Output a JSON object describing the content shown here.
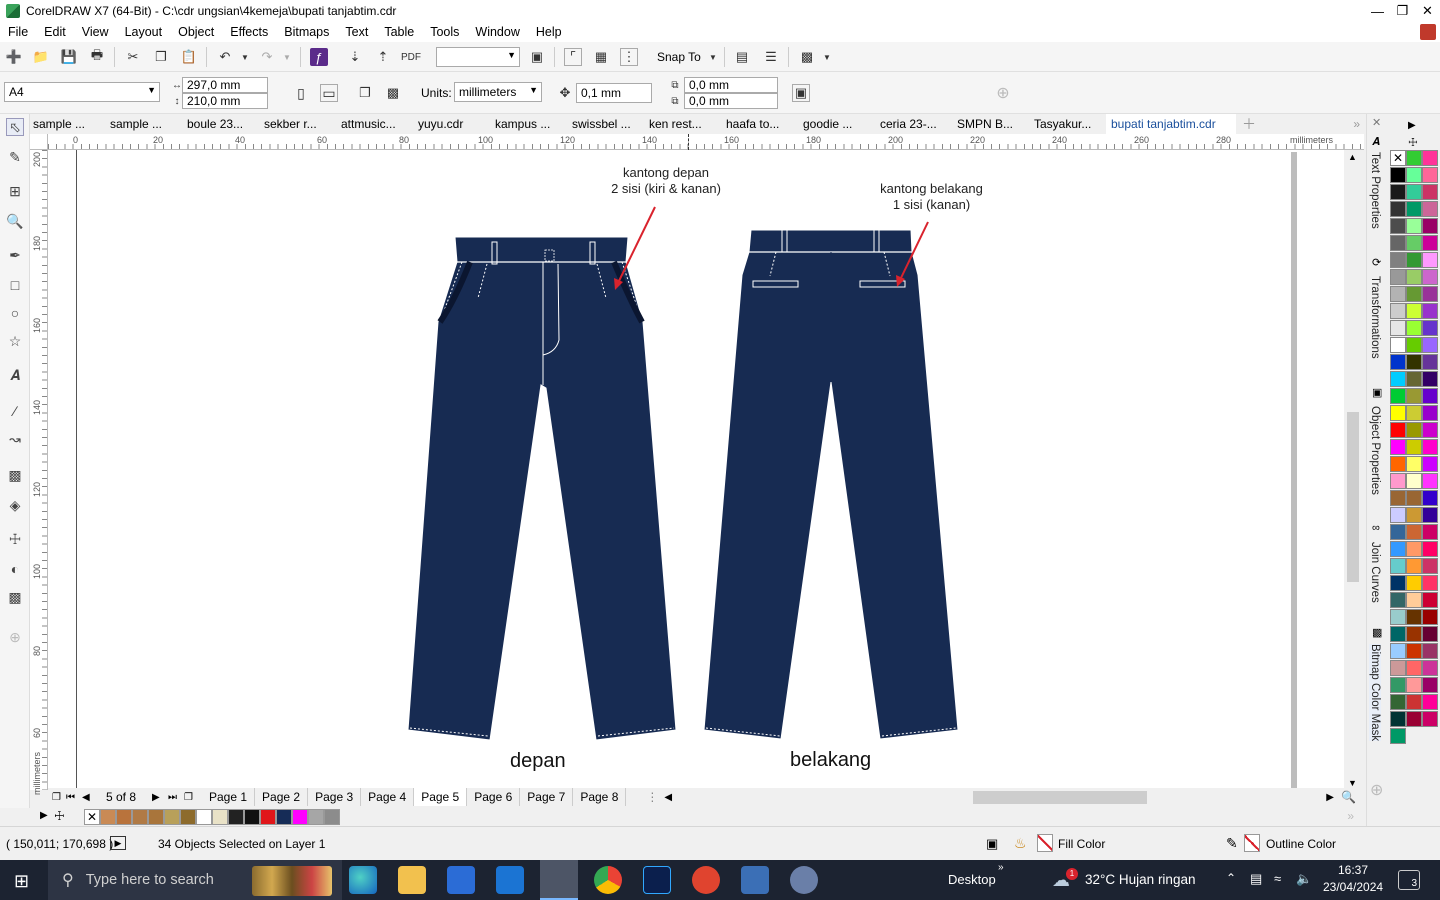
{
  "window": {
    "title": "CorelDRAW X7 (64-Bit) - C:\\cdr ungsian\\4kemeja\\bupati tanjabtim.cdr"
  },
  "menu": [
    "File",
    "Edit",
    "View",
    "Layout",
    "Object",
    "Effects",
    "Bitmaps",
    "Text",
    "Table",
    "Tools",
    "Window",
    "Help"
  ],
  "standard_toolbar": {
    "snap_label": "Snap To",
    "zoom_value": ""
  },
  "property_bar": {
    "page_size": "A4",
    "width": "297,0 mm",
    "height": "210,0 mm",
    "units_label": "Units:",
    "units_value": "millimeters",
    "nudge": "0,1 mm",
    "dup_x": "0,0 mm",
    "dup_y": "0,0 mm"
  },
  "doc_tabs": [
    "sample ...",
    "sample ...",
    "boule 23...",
    "sekber r...",
    "attmusic...",
    "yuyu.cdr",
    "kampus ...",
    "swissbel ...",
    "ken rest...",
    "haafa to...",
    "goodie ...",
    "ceria 23-...",
    "SMPN B...",
    "Tasyakur...",
    "bupati tanjabtim.cdr"
  ],
  "ruler": {
    "unit": "millimeters",
    "h_ticks": [
      "0",
      "20",
      "40",
      "60",
      "80",
      "100",
      "120",
      "140",
      "160",
      "180",
      "200",
      "220",
      "240",
      "260",
      "280"
    ],
    "v_ticks": [
      "200",
      "180",
      "160",
      "140",
      "120",
      "100",
      "80",
      "60"
    ],
    "v_unit": "millimeters"
  },
  "artwork": {
    "front_pocket_note_1": "kantong depan",
    "front_pocket_note_2": "2 sisi (kiri & kanan)",
    "back_pocket_note_1": "kantong belakang",
    "back_pocket_note_2": "1 sisi (kanan)",
    "front_label": "depan",
    "back_label": "belakang",
    "pants_color": "#172b52",
    "arrow_color": "#d9232d"
  },
  "page_nav": {
    "counter": "5 of 8",
    "pages": [
      "Page 1",
      "Page 2",
      "Page 3",
      "Page 4",
      "Page 5",
      "Page 6",
      "Page 7",
      "Page 8"
    ],
    "active": "Page 5"
  },
  "status": {
    "coords": "( 150,011; 170,698 )",
    "selection": "34 Objects Selected on Layer 1",
    "fill_label": "Fill Color",
    "outline_label": "Outline Color"
  },
  "dockers": [
    "Text Properties",
    "Transformations",
    "Object Properties",
    "Join Curves",
    "Bitmap Color Mask"
  ],
  "doc_palette": [
    "#c98a55",
    "#b9733c",
    "#b07a45",
    "#a9753b",
    "#b8a05a",
    "#8d6b2c",
    "#ffffff",
    "#e9e2c7",
    "#222222",
    "#111111",
    "#e0161a",
    "#162c57",
    "#ff00ff",
    "#a6a6a6",
    "#8c8c8c"
  ],
  "palette_cols": [
    [
      "#000000",
      "#1a1a1a",
      "#333333",
      "#4d4d4d",
      "#666666",
      "#808080",
      "#999999",
      "#b3b3b3",
      "#cccccc",
      "#e6e6e6",
      "#ffffff",
      "#0033cc",
      "#00ccff",
      "#00cc33",
      "#ffff00",
      "#ff0000",
      "#ff00ff",
      "#ff6600",
      "#ff99cc",
      "#996633",
      "#ccccff",
      "#336699",
      "#3399ff",
      "#66cccc",
      "#003366",
      "#336666",
      "#99cccc",
      "#006666",
      "#99ccff",
      "#cc9999",
      "#339966",
      "#336633",
      "#003333",
      "#009966"
    ],
    [
      "#33cc33",
      "#66ff99",
      "#33cc99",
      "#009966",
      "#99ff99",
      "#66cc66",
      "#339933",
      "#99cc66",
      "#669933",
      "#ccff33",
      "#99ff33",
      "#66cc00",
      "#333300",
      "#666633",
      "#999933",
      "#cccc33",
      "#999900",
      "#cccc00",
      "#ffff66",
      "#ffffcc",
      "#996633",
      "#cc9933",
      "#cc6633",
      "#ff9966",
      "#ff9933",
      "#ffcc00",
      "#ffcc99",
      "#663300",
      "#993300",
      "#cc3300",
      "#ff6666",
      "#ff9999",
      "#cc3333",
      "#990033"
    ],
    [
      "#ff3399",
      "#ff6699",
      "#cc3366",
      "#cc6699",
      "#990066",
      "#cc0099",
      "#ff99ff",
      "#cc66cc",
      "#993399",
      "#9933cc",
      "#6633cc",
      "#9966ff",
      "#663399",
      "#330066",
      "#6600cc",
      "#9900cc",
      "#cc00cc",
      "#ff00cc",
      "#cc00ff",
      "#ff33ff",
      "#3300cc",
      "#330099",
      "#cc0066",
      "#ff0066",
      "#cc3366",
      "#ff3366",
      "#cc0033",
      "#990000",
      "#660033",
      "#993366",
      "#cc3399",
      "#990066",
      "#ff0099",
      "#cc0066"
    ]
  ],
  "taskbar": {
    "search_placeholder": "Type here to search",
    "desktop": "Desktop",
    "weather": "32°C  Hujan ringan",
    "time": "16:37",
    "date": "23/04/2024",
    "notif_count": "3",
    "weather_badge": "1"
  }
}
